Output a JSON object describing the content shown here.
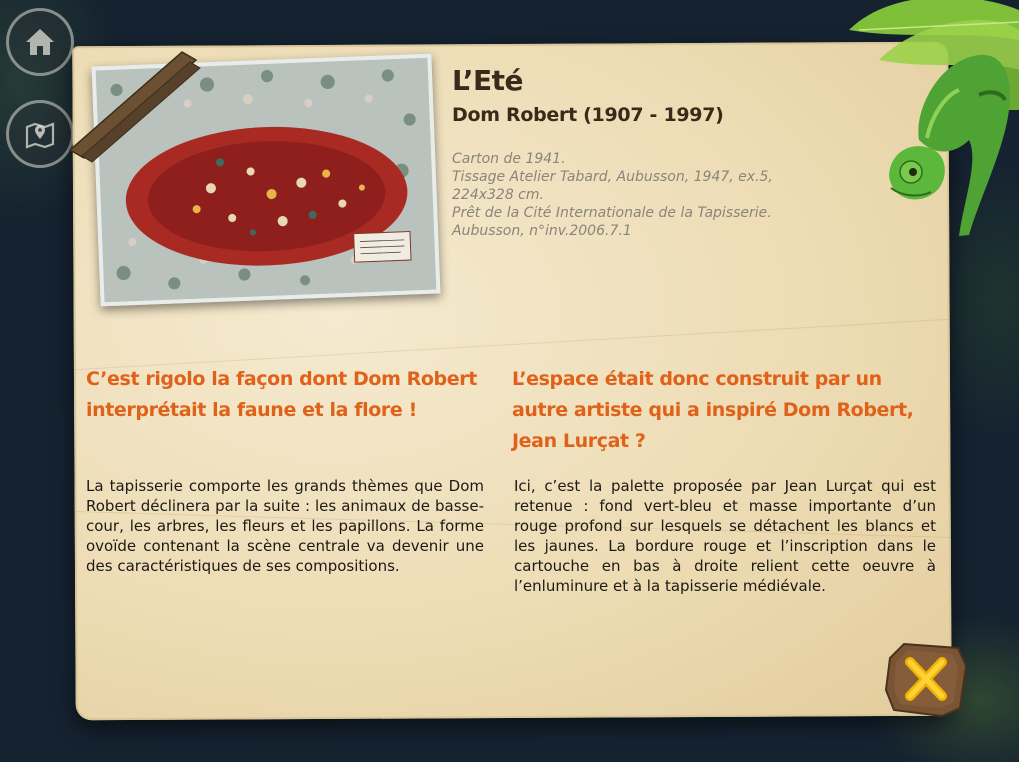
{
  "nav": {
    "home_icon": "home-icon",
    "map_icon": "map-location-icon"
  },
  "artwork": {
    "title": "L’Eté",
    "artist": "Dom Robert (1907 - 1997)",
    "details": [
      "Carton de 1941.",
      "Tissage Atelier Tabard, Aubusson, 1947, ex.5,",
      "224x328 cm.",
      "Prêt de la Cité Internationale de la Tapisserie.",
      "Aubusson, n°inv.2006.7.1"
    ]
  },
  "sections": [
    {
      "question": "C’est rigolo la façon dont Dom Robert interprétait la faune et la flore !",
      "text": "La tapisserie comporte les grands thèmes que Dom Robert déclinera par la suite : les animaux de basse-cour, les arbres, les fleurs et les papillons. La forme ovoïde contenant la scène centrale va devenir une des caractéristiques de ses compositions."
    },
    {
      "question": "L’espace était donc construit par un autre artiste qui a inspiré Dom Robert, Jean Lurçat ?",
      "text": "Ici, c’est la palette proposée par Jean Lurçat qui est retenue : fond vert-bleu et masse importante d’un rouge profond sur lesquels se détachent les blancs et les jaunes. La bordure rouge et l’inscription dans le cartouche en bas à droite relient cette oeuvre à l’enluminure et à la tapisserie médiévale."
    }
  ],
  "close": {
    "icon": "close-x-icon"
  },
  "colors": {
    "accent": "#e0621a",
    "title": "#3a2a1a",
    "meta": "#8a847a",
    "parchment": "#eddcb4"
  }
}
